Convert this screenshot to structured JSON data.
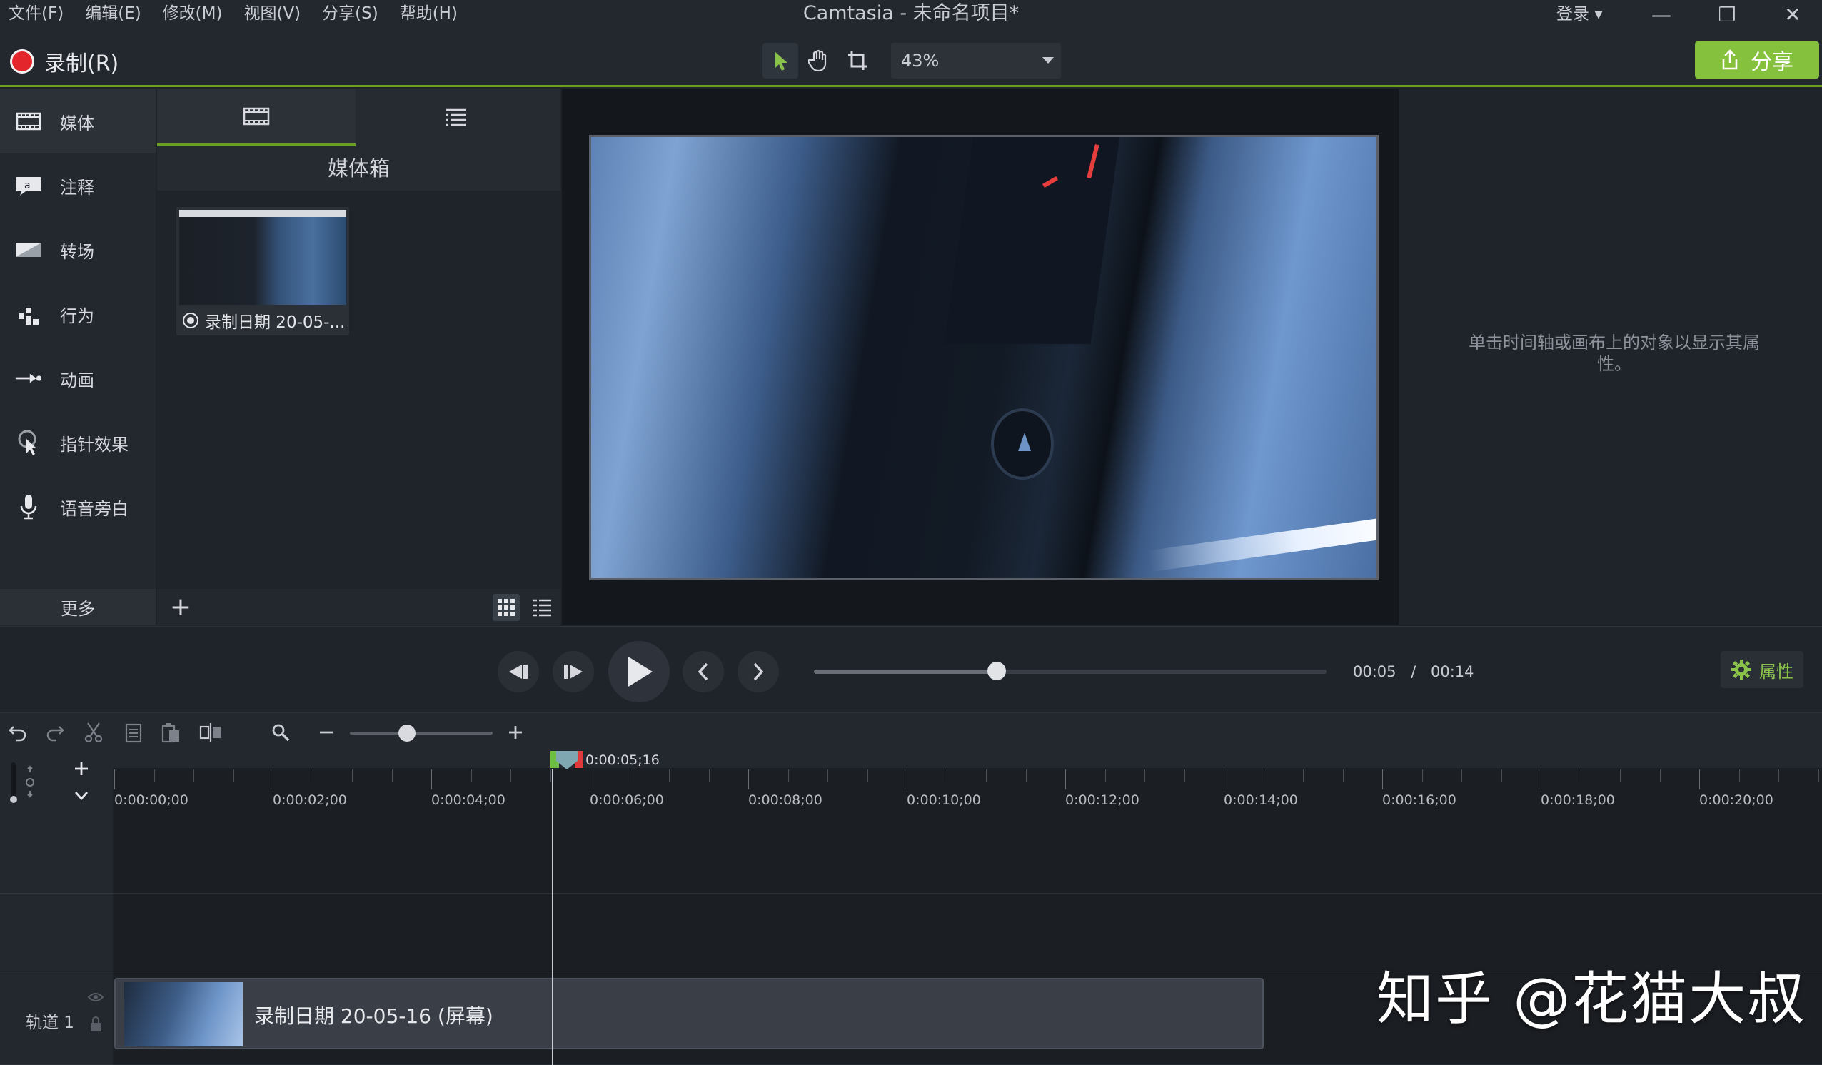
{
  "menu": [
    "文件(F)",
    "编辑(E)",
    "修改(M)",
    "视图(V)",
    "分享(S)",
    "帮助(H)"
  ],
  "app_title": "Camtasia - 未命名项目*",
  "login": "登录 ▾",
  "window_controls": {
    "minimize": "—",
    "restore": "❐",
    "close": "✕"
  },
  "toolbar": {
    "record_label": "录制(R)",
    "zoom": "43%",
    "share_label": "分享"
  },
  "sidebar": {
    "items": [
      {
        "label": "媒体",
        "icon": "film-icon"
      },
      {
        "label": "注释",
        "icon": "annotation-icon"
      },
      {
        "label": "转场",
        "icon": "transition-icon"
      },
      {
        "label": "行为",
        "icon": "behavior-icon"
      },
      {
        "label": "动画",
        "icon": "animation-icon"
      },
      {
        "label": "指针效果",
        "icon": "cursor-effect-icon"
      },
      {
        "label": "语音旁白",
        "icon": "microphone-icon"
      }
    ],
    "more_label": "更多",
    "add_label": "+"
  },
  "media_bin": {
    "title": "媒体箱",
    "items": [
      {
        "label": "录制日期 20-05-..."
      }
    ]
  },
  "properties": {
    "hint": "单击时间轴或画布上的对象以显示其属性。",
    "button_label": "属性"
  },
  "playback": {
    "current": "00:05",
    "separator": "/",
    "total": "00:14",
    "progress": 0.357
  },
  "timeline": {
    "zoom_level": 0.4,
    "playhead_time": "0:00:05;16",
    "ruler_labels": [
      "0:00:00;00",
      "0:00:02;00",
      "0:00:04;00",
      "0:00:06;00",
      "0:00:08;00",
      "0:00:10;00",
      "0:00:12;00",
      "0:00:14;00",
      "0:00:16;00",
      "0:00:18;00",
      "0:00:20;00"
    ],
    "track_label": "轨道 1",
    "clip_label": "录制日期 20-05-16 (屏幕)"
  },
  "watermark": "知乎 @花猫大叔"
}
